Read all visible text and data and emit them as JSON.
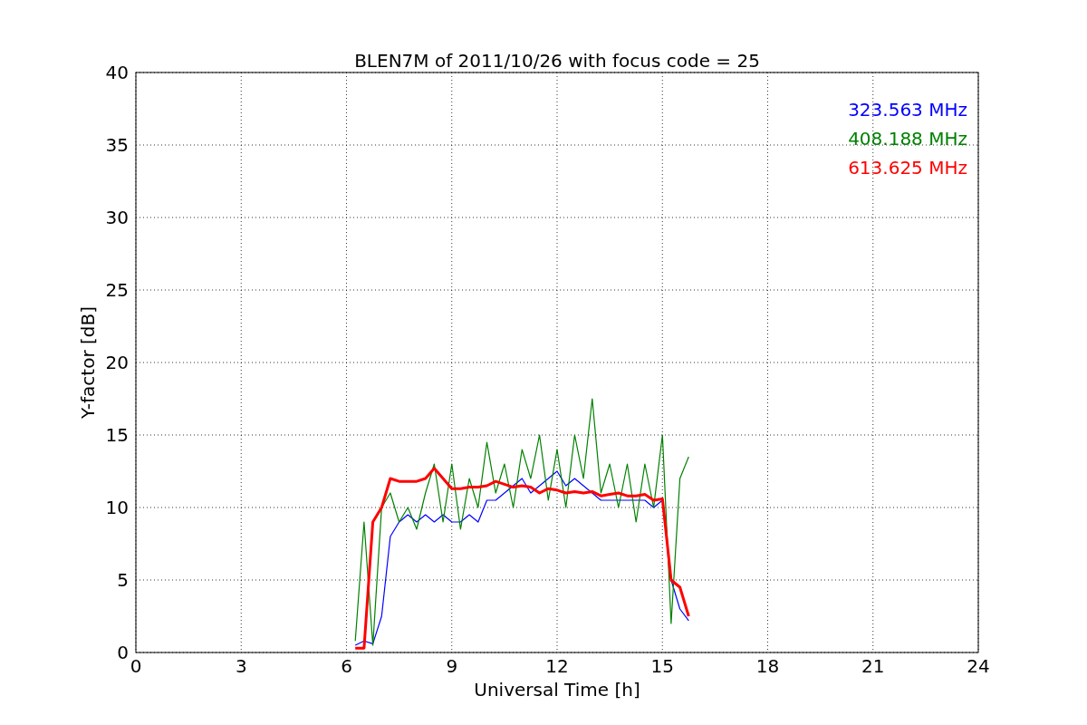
{
  "chart_data": {
    "type": "line",
    "title": "BLEN7M of 2011/10/26 with focus code = 25",
    "xlabel": "Universal Time [h]",
    "ylabel": "Y-factor [dB]",
    "x": [
      6.25,
      6.5,
      6.75,
      7,
      7.25,
      7.5,
      7.75,
      8,
      8.25,
      8.5,
      8.75,
      9,
      9.25,
      9.5,
      9.75,
      10,
      10.25,
      10.5,
      10.75,
      11,
      11.25,
      11.5,
      11.75,
      12,
      12.25,
      12.5,
      12.75,
      13,
      13.25,
      13.5,
      13.75,
      14,
      14.25,
      14.5,
      14.75,
      15,
      15.25,
      15.5,
      15.75
    ],
    "series": [
      {
        "name": "323.563 MHz",
        "color": "#0000ff",
        "values": [
          0.5,
          0.8,
          0.6,
          2.5,
          8,
          9,
          9.5,
          9,
          9.5,
          9,
          9.5,
          9,
          9,
          9.5,
          9,
          10.5,
          10.5,
          11,
          11.5,
          12,
          11,
          11.5,
          12,
          12.5,
          11.5,
          12,
          11.5,
          11,
          10.5,
          10.5,
          10.5,
          10.5,
          10.5,
          10.5,
          10,
          10.5,
          5,
          3,
          2.2
        ]
      },
      {
        "name": "408.188 MHz",
        "color": "#008000",
        "values": [
          0.8,
          9,
          0.5,
          10,
          11,
          9,
          10,
          8.5,
          11,
          13,
          9,
          13,
          8.5,
          12,
          10,
          14.5,
          11,
          13,
          10,
          14,
          12,
          15,
          10.5,
          14,
          10,
          15,
          12,
          17.5,
          11,
          13,
          10,
          13,
          9,
          13,
          10,
          15,
          2,
          12,
          13.5
        ]
      },
      {
        "name": "613.625 MHz",
        "color": "#ff0000",
        "values": [
          0.3,
          0.3,
          9,
          10,
          12,
          11.8,
          11.8,
          11.8,
          12,
          12.7,
          12,
          11.3,
          11.3,
          11.4,
          11.4,
          11.5,
          11.8,
          11.6,
          11.4,
          11.5,
          11.4,
          11,
          11.3,
          11.2,
          11,
          11.1,
          11,
          11.1,
          10.8,
          10.9,
          11,
          10.8,
          10.8,
          10.9,
          10.5,
          10.6,
          5,
          4.5,
          2.5
        ]
      }
    ],
    "xlim": [
      0,
      24
    ],
    "ylim": [
      0,
      40
    ],
    "xticks": [
      0,
      3,
      6,
      9,
      12,
      15,
      18,
      21,
      24
    ],
    "yticks": [
      0,
      5,
      10,
      15,
      20,
      25,
      30,
      35,
      40
    ],
    "grid": true
  }
}
